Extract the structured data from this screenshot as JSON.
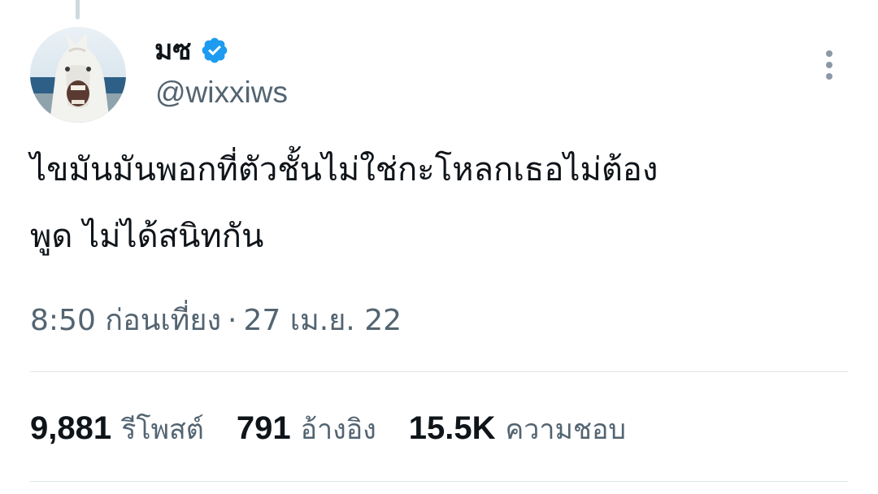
{
  "tweet": {
    "author": {
      "display_name": "มซ",
      "handle": "@wixxiws",
      "verified": true,
      "verified_color": "#1d9bf0"
    },
    "text": "ไขมันมันพอกที่ตัวชั้นไม่ใช่กะโหลกเธอไม่ต้อง\nพูด ไม่ได้สนิทกัน",
    "time": "8:50 ก่อนเที่ยง",
    "separator": "·",
    "date": "27 เม.ย. 22"
  },
  "stats": {
    "retweets": {
      "count": "9,881",
      "label": "รีโพสต์"
    },
    "quotes": {
      "count": "791",
      "label": "อ้างอิง"
    },
    "likes": {
      "count": "15.5K",
      "label": "ความชอบ"
    }
  },
  "icons": {
    "verified": "verified-badge-icon",
    "more": "more-vertical-icon"
  },
  "colors": {
    "text_primary": "#0f1419",
    "text_secondary": "#536471",
    "accent": "#1d9bf0",
    "divider": "#dfe5e8"
  }
}
